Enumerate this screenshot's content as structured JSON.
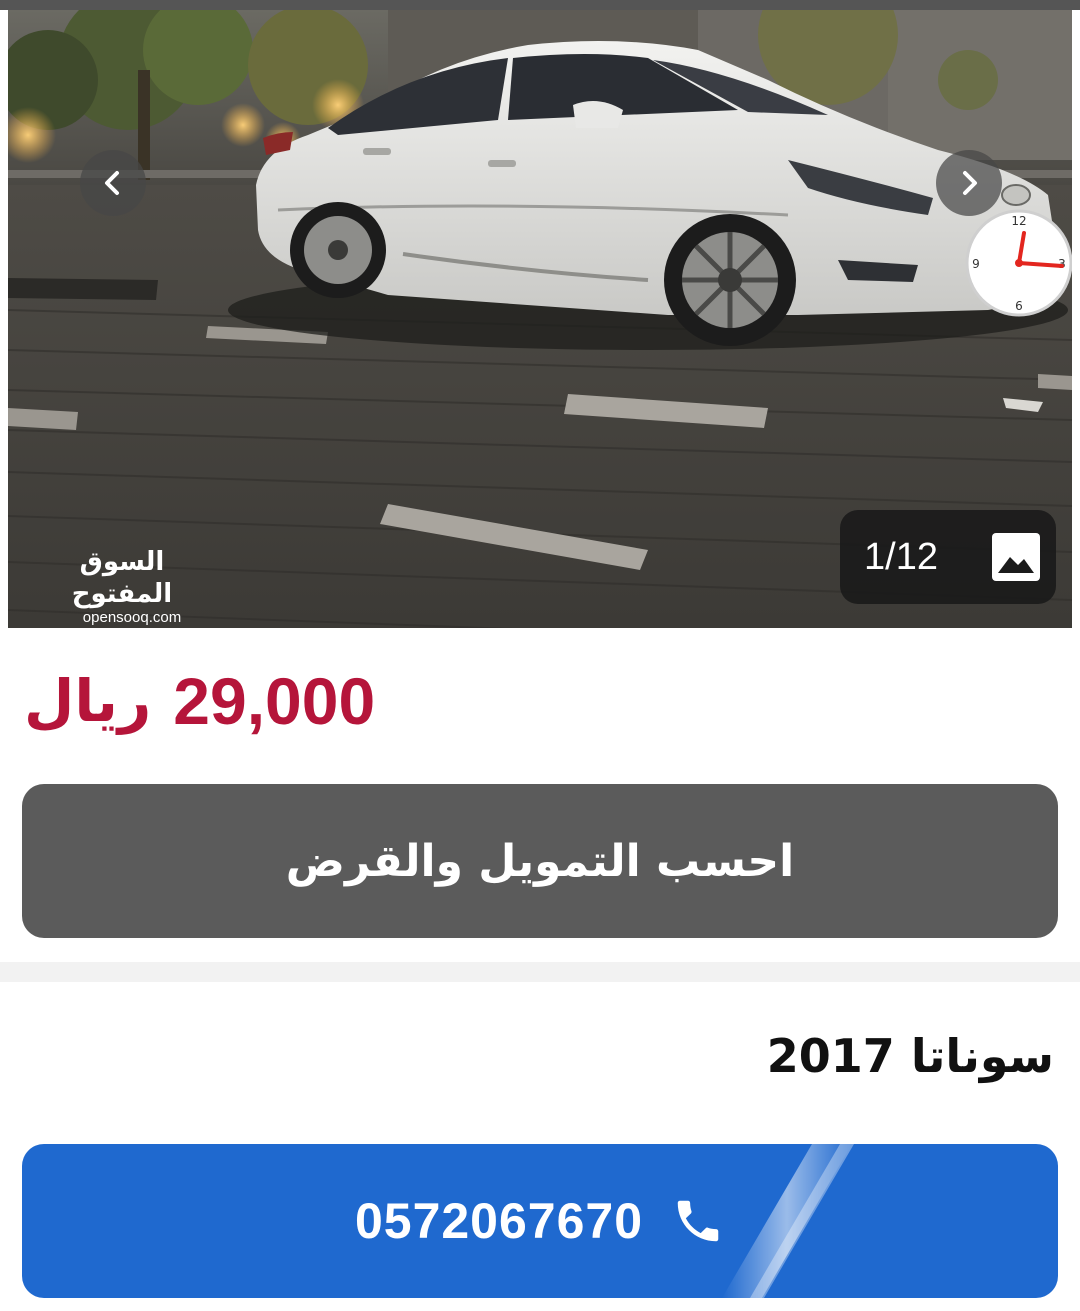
{
  "gallery": {
    "counter": "1/12",
    "watermark_ar": "السوق المفتوح",
    "watermark_en": "opensooq.com",
    "icons": {
      "prev": "chevron-left-icon",
      "next": "chevron-right-icon",
      "counter": "image-icon",
      "badge": "clock-icon"
    }
  },
  "listing": {
    "price_amount": "29,000",
    "price_currency": "ريال",
    "title": "سوناتا 2017"
  },
  "actions": {
    "finance_label": "احسب التمويل والقرض",
    "phone_number": "0572067670",
    "phone_icon": "phone-icon"
  },
  "colors": {
    "price": "#b5153a",
    "finance_button": "#5b5b5b",
    "call_button": "#1f69cf"
  }
}
